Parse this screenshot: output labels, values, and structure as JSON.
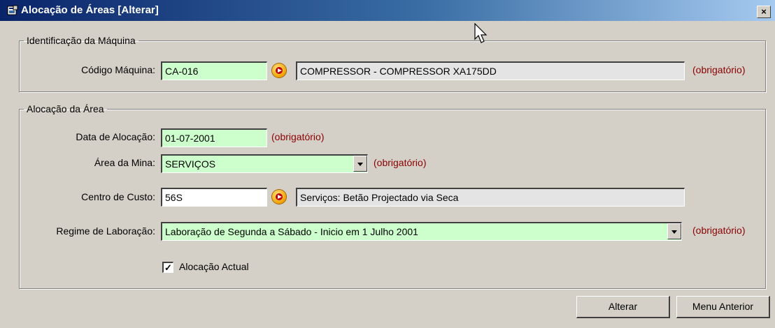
{
  "window": {
    "title": "Alocação de Áreas [Alterar]",
    "close_glyph": "×"
  },
  "machine_group": {
    "legend": "Identificação da Máquina",
    "code_label": "Código Máquina:",
    "code_value": "CA-016",
    "description_value": "COMPRESSOR - COMPRESSOR XA175DD",
    "required": "(obrigatório)"
  },
  "area_group": {
    "legend": "Alocação da Área",
    "date_label": "Data de Alocação:",
    "date_value": "01-07-2001",
    "date_required": "(obrigatório)",
    "mine_area_label": "Área da Mina:",
    "mine_area_value": "SERVIÇOS",
    "mine_area_required": "(obrigatório)",
    "cost_center_label": "Centro de Custo:",
    "cost_center_value": "56S",
    "cost_center_description": "Serviços: Betão Projectado via Seca",
    "regime_label": "Regime de Laboração:",
    "regime_value": "Laboração de Segunda a Sábado - Inicio em 1 Julho 2001",
    "regime_required": "(obrigatório)",
    "current_allocation_label": "Alocação Actual",
    "current_allocation_checked": true
  },
  "buttons": {
    "alter": "Alterar",
    "back": "Menu Anterior"
  },
  "colors": {
    "required_field": "#ccffcc",
    "required_text": "#8b0000",
    "title_start": "#0a246a",
    "title_end": "#a6caf0"
  }
}
